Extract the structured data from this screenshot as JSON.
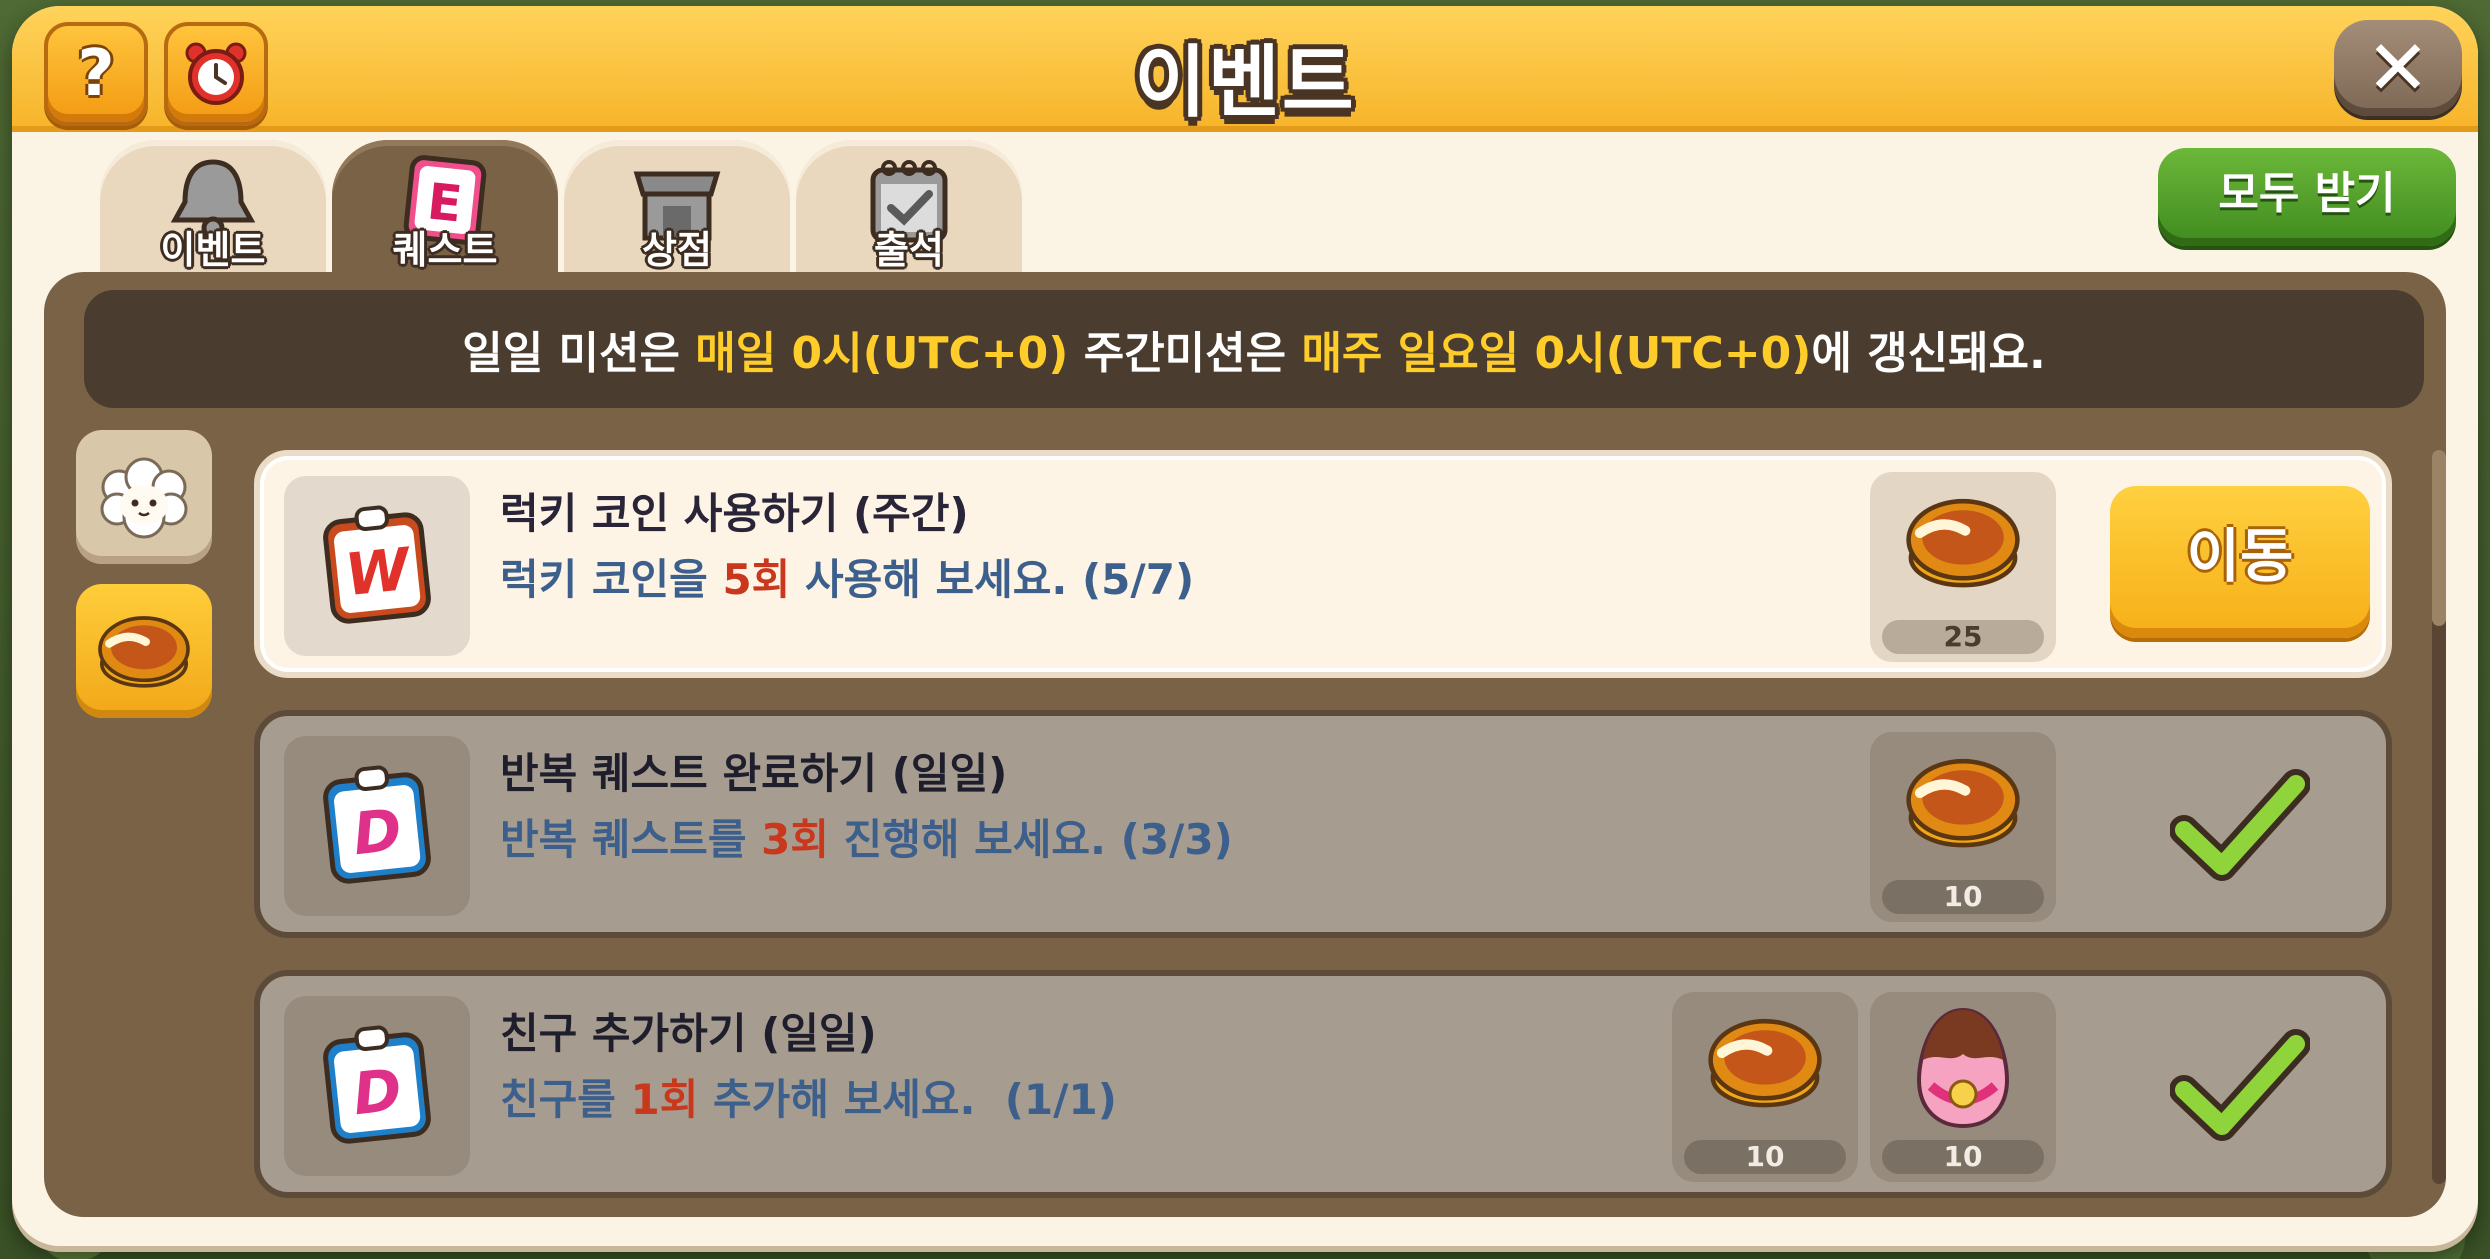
{
  "window": {
    "title": "이벤트"
  },
  "header": {
    "help_glyph": "?",
    "close_glyph": "✕"
  },
  "tabs": [
    {
      "label": "이벤트",
      "icon": "bell-icon",
      "active": false
    },
    {
      "label": "퀘스트",
      "icon": "quest-e-icon",
      "active": true
    },
    {
      "label": "상점",
      "icon": "shop-icon",
      "active": false
    },
    {
      "label": "출석",
      "icon": "calendar-check-icon",
      "active": false
    }
  ],
  "claim_all_label": "모두 받기",
  "notice": {
    "p1": "일일 미션은 ",
    "h1": "매일 0시(UTC+0)",
    "p2": " 주간미션은 ",
    "h2": "매주 일요일 0시(UTC+0)",
    "p3": "에 갱신돼요."
  },
  "side_filters": [
    {
      "icon": "sheep-icon",
      "selected": false
    },
    {
      "icon": "lucky-coin-icon",
      "selected": true
    }
  ],
  "quests": [
    {
      "badge": "W",
      "title": "럭키 코인 사용하기 (주간)",
      "desc_pre": "럭키 코인을 ",
      "desc_num": "5회",
      "desc_post": " 사용해 보세요. (5/7)",
      "rewards": [
        {
          "icon": "lucky-coin-icon",
          "count": "25"
        }
      ],
      "action": "이동",
      "status": "in-progress"
    },
    {
      "badge": "D",
      "title": "반복 퀘스트 완료하기 (일일)",
      "desc_pre": "반복 퀘스트를 ",
      "desc_num": "3회",
      "desc_post": " 진행해 보세요. (3/3)",
      "rewards": [
        {
          "icon": "lucky-coin-icon",
          "count": "10"
        }
      ],
      "status": "completed"
    },
    {
      "badge": "D",
      "title": "친구 추가하기 (일일)",
      "desc_pre": "친구를 ",
      "desc_num": "1회",
      "desc_post": " 추가해 보세요.  (1/1)",
      "rewards": [
        {
          "icon": "lucky-coin-icon",
          "count": "10"
        },
        {
          "icon": "cocoa-egg-icon",
          "count": "10"
        }
      ],
      "status": "completed"
    }
  ],
  "colors": {
    "title_bar": "#f7b52b",
    "panel": "#7a6247",
    "highlight": "#ffcd2a",
    "count_red": "#c9371c",
    "claim_green": "#3f8a1e"
  }
}
